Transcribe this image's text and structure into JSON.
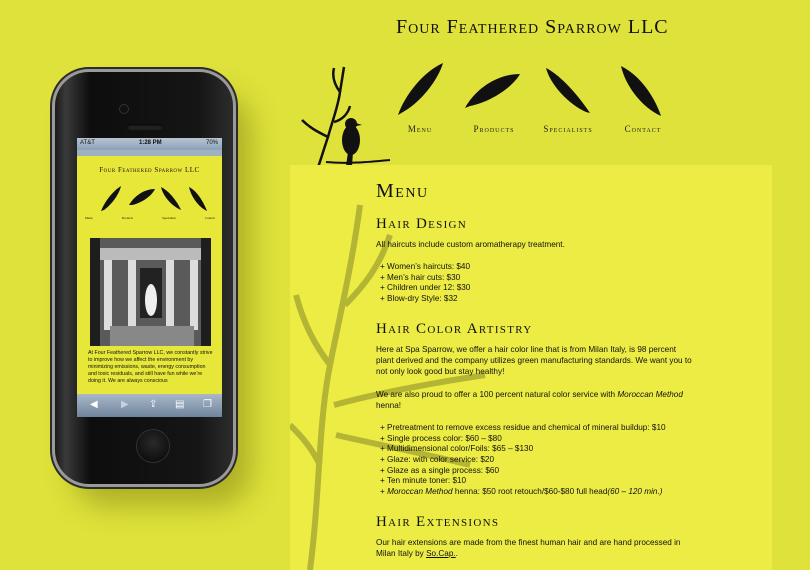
{
  "site": {
    "title": "Four Feathered Sparrow LLC",
    "nav": [
      "Menu",
      "Products",
      "Specialists",
      "Contact"
    ]
  },
  "content": {
    "heading": "Menu",
    "hair_design": {
      "title": "Hair Design",
      "intro": "All haircuts include custom aromatherapy treatment.",
      "items": [
        "+ Women’s haircuts: $40",
        "+ Men’s hair cuts: $30",
        "+ Children under 12: $30",
        "+ Blow-dry Style: $32"
      ]
    },
    "hair_color": {
      "title": "Hair Color Artistry",
      "p1": "Here at Spa Sparrow, we offer a hair color line that is from Milan Italy, is 98 percent plant derived and the company utilizes green manufacturing standards. We want you to not only look good but stay healthy!",
      "p2_prefix": "We are also proud to offer a 100 percent natural color service with ",
      "p2_em": "Moroccan Method",
      "p2_suffix": " henna!",
      "items": [
        "+ Pretreatment to remove excess residue and chemical of mineral buildup: $10",
        "+ Single process color: $60 – $80",
        "+ Multidimensional color/Foils: $65 – $130",
        "+ Glaze: with color service: $20",
        "+ Glaze as a single process: $60",
        "+ Ten minute toner: $10"
      ],
      "last_item_prefix": "+ ",
      "last_item_em": "Moroccan Method",
      "last_item_mid": " henna: $50 root retouch/$60-$80 full head",
      "last_item_em2": "(60 – 120 min.)"
    },
    "hair_extensions": {
      "title": "Hair Extensions",
      "p_prefix": "Our hair extensions are made from the finest human hair and are hand processed in Milan Italy by ",
      "link": "So.Cap.",
      "p_suffix": "."
    }
  },
  "phone": {
    "carrier": "AT&T",
    "time": "1:28 PM",
    "battery": "70%",
    "mini_title": "Four Feathered Sparrow LLC",
    "mini_nav": [
      "Menu",
      "Products",
      "Specialists",
      "Contact"
    ],
    "mini_text": "At Four Feathered Sparrow LLC, we constantly strive to improve how we affect the environment by minimizing emissions, waste, energy consumption and toxic residuals, and still have fun while we’re doing it. We are always conscious"
  },
  "colors": {
    "background": "#dfe23a",
    "panel": "#ecec45",
    "ink": "#111111"
  },
  "icons": [
    "bird-icon",
    "feather-icon",
    "tree-branch-icon",
    "back-arrow-icon",
    "forward-arrow-icon",
    "share-icon",
    "bookmarks-icon",
    "tabs-icon",
    "home-button-icon"
  ]
}
